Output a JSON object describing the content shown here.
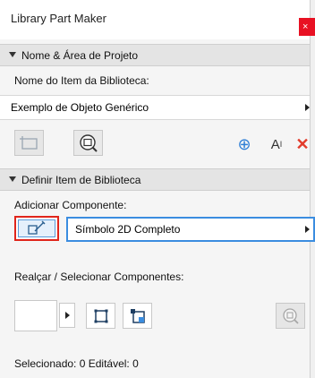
{
  "window": {
    "title": "Library Part Maker",
    "close_glyph": "×"
  },
  "section1": {
    "label": "Nome & Área de Projeto",
    "field_label": "Nome do Item da Biblioteca:",
    "field_value": "Exemplo de Objeto Genérico",
    "toolbar": {
      "icons": [
        "select-area-icon",
        "zoom-to-selection-icon",
        "add-circle-icon",
        "text-style-icon",
        "delete-icon"
      ],
      "text_icon_glyph": "A",
      "text_icon_sup": "I",
      "delete_glyph": "✕",
      "add_glyph": "⊕"
    }
  },
  "section2": {
    "label": "Definir Item de Biblioteca",
    "add_label": "Adicionar Componente:",
    "component_value": "Símbolo 2D Completo",
    "highlight_label": "Realçar / Selecionar Componentes:",
    "status": "Selecionado: 0 Editável: 0"
  },
  "colors": {
    "accent_blue": "#3b8de0",
    "highlight_red": "#e0251b",
    "close_red": "#e81123",
    "delete_red": "#e23b2b",
    "add_blue": "#2f7fd6"
  }
}
